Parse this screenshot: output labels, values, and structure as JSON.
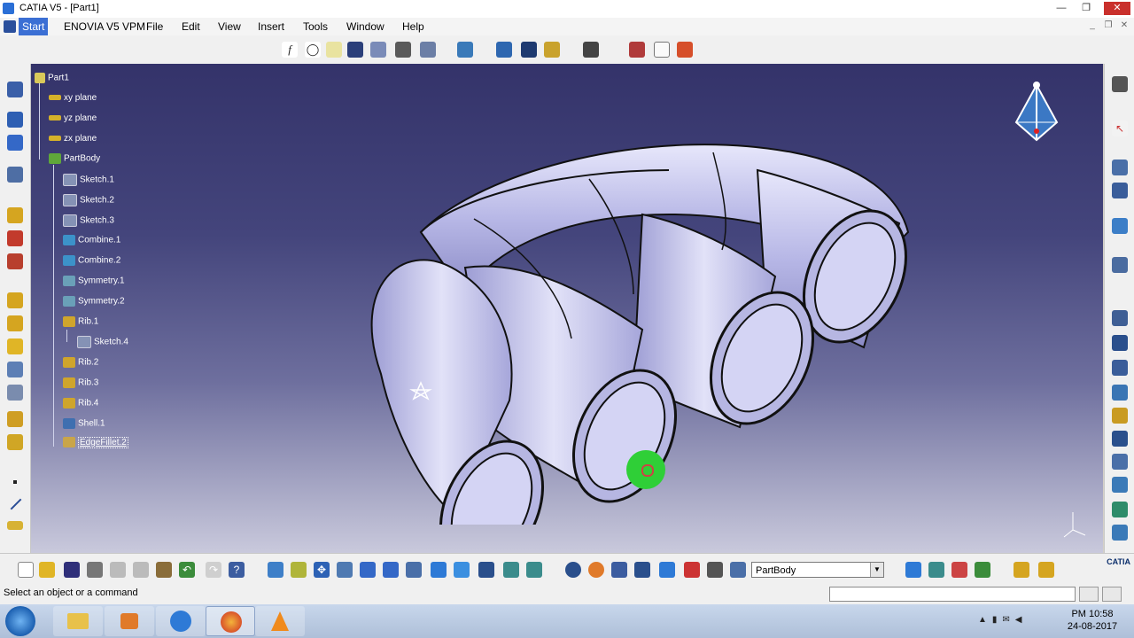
{
  "window": {
    "title": "CATIA V5 - [Part1]",
    "controls": {
      "minimize": "—",
      "maximize": "❐",
      "close": "✕",
      "doc_minimize": "_",
      "doc_restore": "❐",
      "doc_close": "✕"
    }
  },
  "menu": [
    "Start",
    "ENOVIA V5 VPM",
    "File",
    "Edit",
    "View",
    "Insert",
    "Tools",
    "Window",
    "Help"
  ],
  "tree": {
    "root": "Part1",
    "items": [
      {
        "label": "xy plane",
        "icon": "plane-icon"
      },
      {
        "label": "yz plane",
        "icon": "plane-icon"
      },
      {
        "label": "zx plane",
        "icon": "plane-icon"
      },
      {
        "label": "PartBody",
        "icon": "partbody-icon"
      },
      {
        "label": "Sketch.1",
        "icon": "sketch-icon"
      },
      {
        "label": "Sketch.2",
        "icon": "sketch-icon"
      },
      {
        "label": "Sketch.3",
        "icon": "sketch-icon"
      },
      {
        "label": "Combine.1",
        "icon": "combine-icon"
      },
      {
        "label": "Combine.2",
        "icon": "combine-icon"
      },
      {
        "label": "Symmetry.1",
        "icon": "symmetry-icon"
      },
      {
        "label": "Symmetry.2",
        "icon": "symmetry-icon"
      },
      {
        "label": "Rib.1",
        "icon": "rib-icon"
      },
      {
        "label": "Sketch.4",
        "icon": "sketch-icon"
      },
      {
        "label": "Rib.2",
        "icon": "rib-icon"
      },
      {
        "label": "Rib.3",
        "icon": "rib-icon"
      },
      {
        "label": "Rib.4",
        "icon": "rib-icon"
      },
      {
        "label": "Shell.1",
        "icon": "shell-icon"
      },
      {
        "label": "EdgeFillet.2",
        "icon": "edgefillet-icon"
      }
    ]
  },
  "toolbar": {
    "current_body": "PartBody",
    "top_icons": [
      "formula-icon",
      "comment-icon",
      "light-icon",
      "table-icon",
      "catalog-icon",
      "apply-material-icon",
      "measure-icon",
      "scan-icon",
      "snap-icon",
      "flag-icon",
      "sheet-icon",
      "capture-icon",
      "text-icon",
      "annotation-icon",
      "render-icon"
    ],
    "bottom_icons": [
      "new-icon",
      "open-icon",
      "save-icon",
      "print-icon",
      "cut-icon",
      "copy-icon",
      "paste-icon",
      "undo-icon",
      "redo-icon",
      "help-icon",
      "fly-icon",
      "fit-all-icon",
      "pan-icon",
      "rotate-icon",
      "zoom-in-icon",
      "zoom-out-icon",
      "normal-view-icon",
      "iso-view-icon",
      "shading-icon",
      "hide-show-icon",
      "swap-icon",
      "refresh-icon",
      "update-icon",
      "axis-icon",
      "measure-icon",
      "constraint-icon",
      "knowledge-icon",
      "publish-icon",
      "sketcher-icon",
      "pad-icon",
      "pocket-icon",
      "shaft-icon",
      "groove-icon"
    ],
    "left_icons": [
      "part-design-icon",
      "sketch-analysis-icon",
      "grid-icon",
      "zoom-area-icon",
      "pad-icon",
      "pocket-icon",
      "shaft-icon",
      "fillet-icon",
      "chamfer-icon",
      "draft-icon",
      "shell-icon",
      "thickness-icon",
      "point-icon",
      "line-icon",
      "plane-icon"
    ],
    "right_icons": [
      "compass-icon",
      "select-icon",
      "sketch-icon",
      "axis-system-icon",
      "boolean-icon",
      "translate-icon",
      "mirror-icon",
      "pattern-icon",
      "scale-icon",
      "surface-icon",
      "thread-icon",
      "hole-icon",
      "rib-icon",
      "slot-icon",
      "stiffener-icon",
      "loft-icon",
      "remove-icon"
    ]
  },
  "statusbar": {
    "message": "Select an object or a command"
  },
  "taskbar": {
    "apps": [
      "start-orb-icon",
      "explorer-icon",
      "media-player-icon",
      "catia-icon",
      "firefox-icon",
      "vlc-icon"
    ],
    "clock_time": "PM 10:58",
    "clock_date": "24-08-2017"
  },
  "brand": {
    "logo_text": "CATIA"
  },
  "colors": {
    "accent": "#3b6fd4",
    "model": "#b9b9e4",
    "cursor_halo": "#2fcf37"
  }
}
